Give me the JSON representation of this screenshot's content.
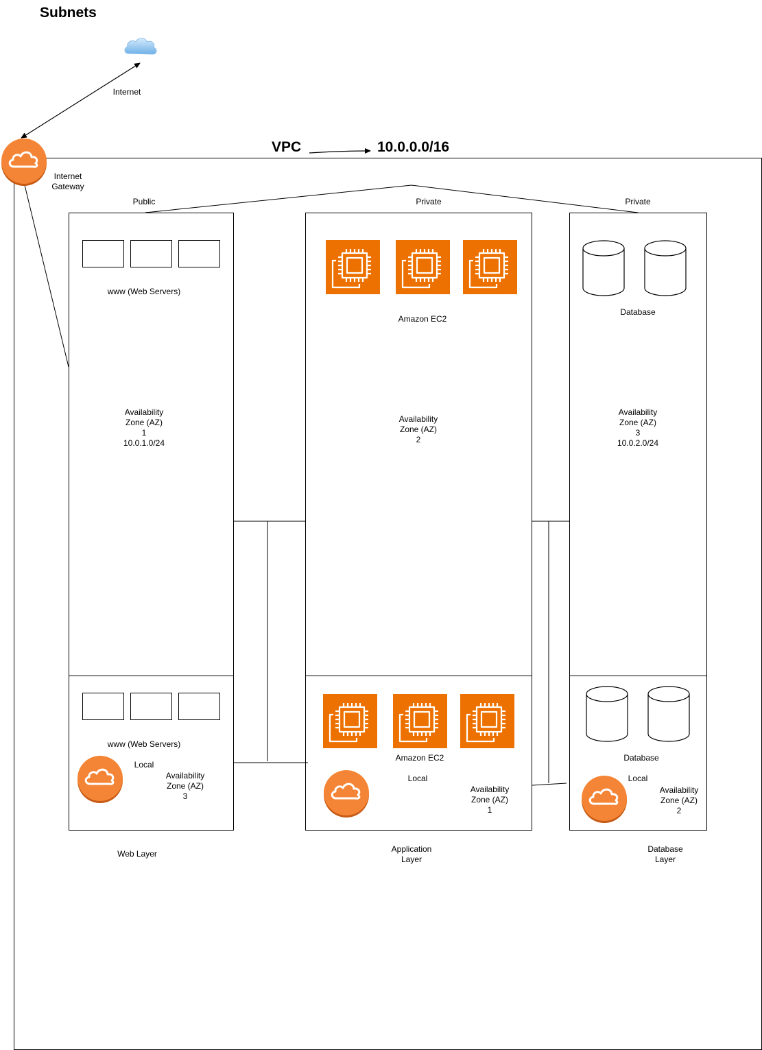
{
  "title": "Subnets",
  "internet_label": "Internet",
  "igw_label": "Internet\nGateway",
  "vpc_label": "VPC",
  "vpc_cidr": "10.0.0.0/16",
  "subnet_types": {
    "public": "Public",
    "private_app": "Private",
    "private_db": "Private"
  },
  "web": {
    "top_label": "www (Web Servers)",
    "top_az": "Availability\nZone (AZ)\n1\n10.0.1.0/24",
    "bottom_label": "www (Web Servers)",
    "local": "Local",
    "bottom_az": "Availability\nZone (AZ)\n3",
    "layer": "Web Layer"
  },
  "app": {
    "top_label": "Amazon EC2",
    "top_az": "Availability\nZone (AZ)\n2",
    "bottom_label": "Amazon EC2",
    "local": "Local",
    "bottom_az": "Availability\nZone (AZ)\n1",
    "layer": "Application\nLayer"
  },
  "db": {
    "top_label": "Database",
    "top_az": "Availability\nZone (AZ)\n3\n10.0.2.0/24",
    "bottom_label": "Database",
    "local": "Local",
    "bottom_az": "Availability\nZone (AZ)\n2",
    "layer": "Database\nLayer"
  },
  "colors": {
    "aws_orange": "#ED7100",
    "gateway_orange": "#F58536",
    "cloud_blue": "#6FB0E8"
  },
  "icons": {
    "internet": "cloud-icon",
    "gateway": "internet-gateway-icon",
    "compute": "ec2-instance-icon",
    "database": "database-cylinder-icon",
    "server": "server-box-icon"
  }
}
